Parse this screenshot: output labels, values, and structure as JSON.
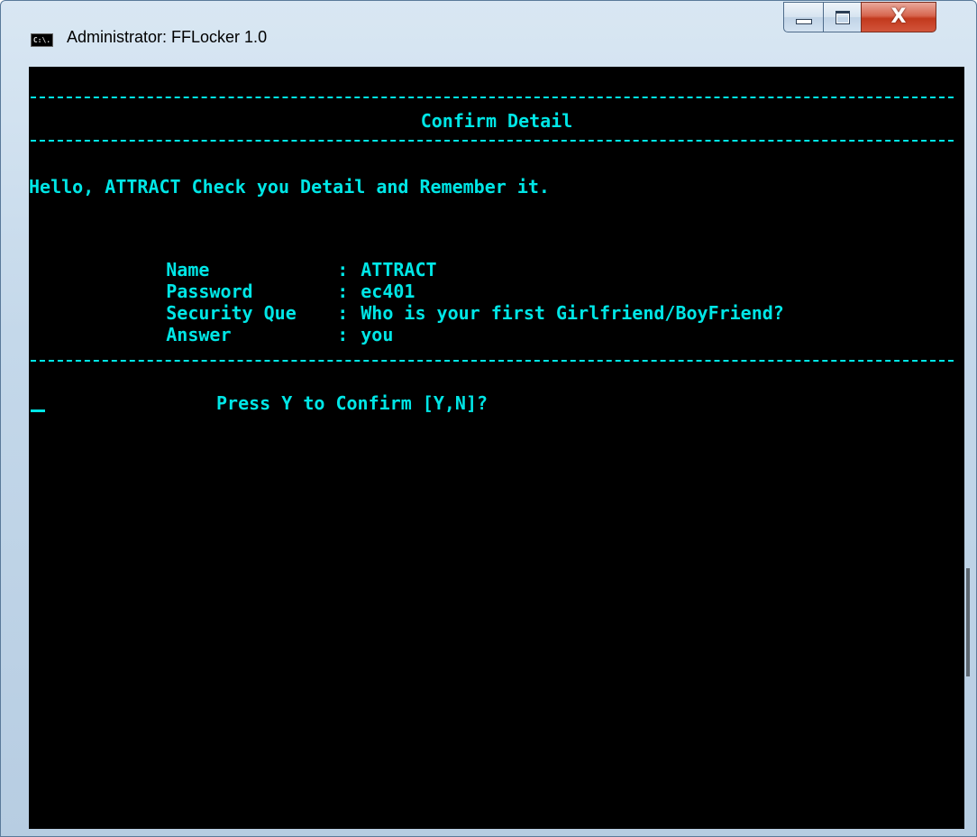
{
  "window": {
    "title": "Administrator:  FFLocker 1.0",
    "icon": "console-icon",
    "icon_text": "C:\\.",
    "controls": {
      "minimize_icon": "minimize-icon",
      "maximize_icon": "maximize-icon",
      "close_icon": "close-icon",
      "close_glyph": "X"
    }
  },
  "console": {
    "text_color": "#00e6e6",
    "background": "#000000",
    "header_title": "Confirm Detail",
    "greeting": "Hello, ATTRACT Check you Detail and Remember it.",
    "details": [
      {
        "label": "Name",
        "sep": ":",
        "value": "ATTRACT"
      },
      {
        "label": "Password",
        "sep": ":",
        "value": "ec401"
      },
      {
        "label": "Security Que",
        "sep": ":",
        "value": "Who is your first Girlfriend/BoyFriend?"
      },
      {
        "label": "Answer",
        "sep": ":",
        "value": "you"
      }
    ],
    "prompt": "Press Y to Confirm [Y,N]?"
  }
}
